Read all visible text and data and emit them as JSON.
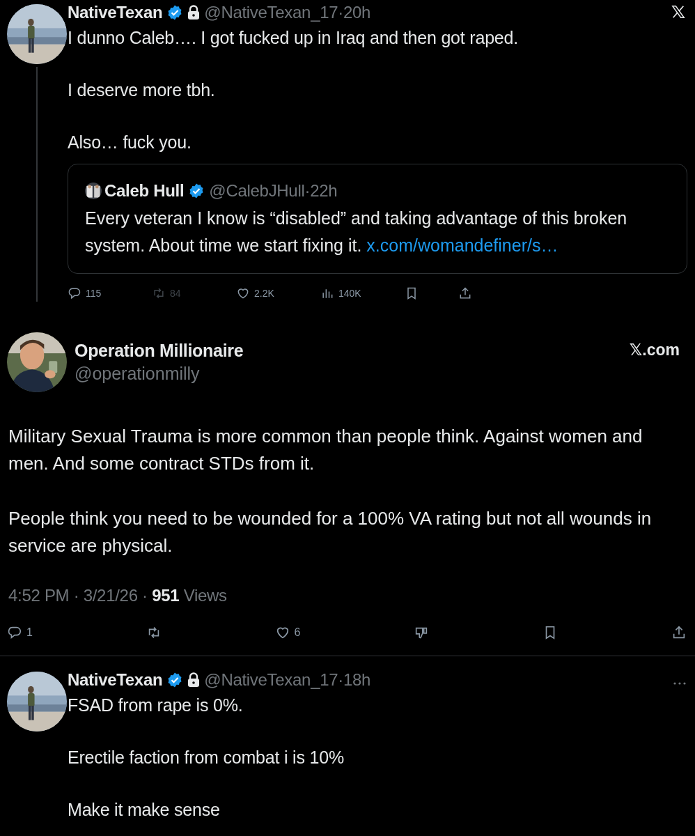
{
  "thread_top": {
    "author": {
      "name": "NativeTexan",
      "verified": true,
      "protected": true,
      "meta": "@NativeTexan_17·20h"
    },
    "paragraphs": [
      "I dunno Caleb…. I got fucked up in Iraq and then got raped.",
      "I deserve more tbh.",
      "Also… fuck you."
    ],
    "quote": {
      "author": {
        "name": "Caleb Hull",
        "verified": true,
        "meta": "@CalebJHull·22h"
      },
      "text": "Every veteran I know is “disabled” and taking advantage of this broken system. About time we start fixing it.",
      "link": "x.com/womandefiner/s…"
    },
    "actions": [
      {
        "kind": "reply",
        "count": "115",
        "disabled": false
      },
      {
        "kind": "repost",
        "count": "84",
        "disabled": true
      },
      {
        "kind": "like",
        "count": "2.2K",
        "disabled": false
      },
      {
        "kind": "views",
        "count": "140K",
        "disabled": false
      },
      {
        "kind": "bookmark",
        "disabled": false
      },
      {
        "kind": "share",
        "disabled": false
      }
    ]
  },
  "main_tweet": {
    "author": {
      "name": "Operation Millionaire",
      "handle": "@operationmilly"
    },
    "source": "𝕏.com",
    "paragraphs": [
      "Military Sexual Trauma is more common than people think. Against women and men. And some contract STDs from it.",
      "People think you need to be wounded for a 100% VA rating but not all wounds in service are physical."
    ],
    "timestamp": "4:52 PM · 3/21/26 · **951** Views",
    "actions": [
      {
        "kind": "reply",
        "count": "1"
      },
      {
        "kind": "repost"
      },
      {
        "kind": "like",
        "count": "6"
      },
      {
        "kind": "dislike"
      },
      {
        "kind": "bookmark"
      },
      {
        "kind": "share"
      }
    ]
  },
  "reply": {
    "author": {
      "name": "NativeTexan",
      "verified": true,
      "protected": true,
      "meta": "@NativeTexan_17·18h"
    },
    "paragraphs": [
      "FSAD from rape is 0%.",
      "Erectile faction from combat i is 10%",
      "Make it make sense"
    ]
  }
}
